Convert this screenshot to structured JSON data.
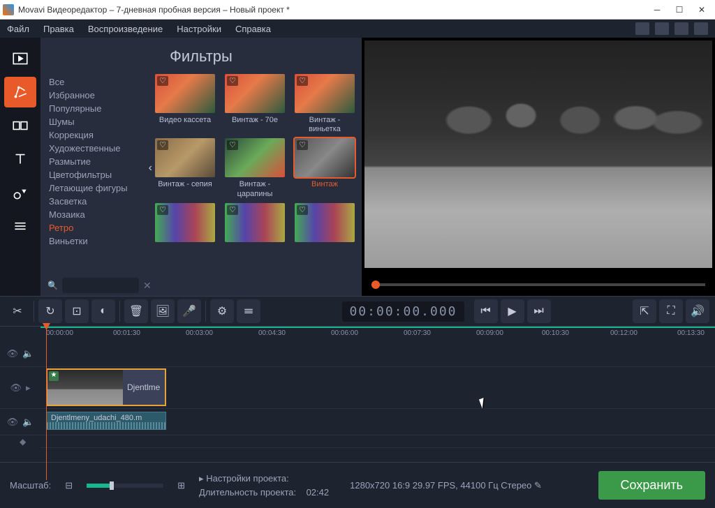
{
  "window": {
    "title": "Movavi Видеоредактор – 7-дневная пробная версия – Новый проект *"
  },
  "menu": {
    "file": "Файл",
    "edit": "Правка",
    "playback": "Воспроизведение",
    "settings": "Настройки",
    "help": "Справка"
  },
  "filters": {
    "title": "Фильтры",
    "categories": [
      "Все",
      "Избранное",
      "Популярные",
      "Шумы",
      "Коррекция",
      "Художественные",
      "Размытие",
      "Цветофильтры",
      "Летающие фигуры",
      "Засветка",
      "Мозаика",
      "Ретро",
      "Виньетки"
    ],
    "active_category_index": 11,
    "items": [
      {
        "label": "Видео кассета"
      },
      {
        "label": "Винтаж - 70е"
      },
      {
        "label": "Винтаж - виньетка"
      },
      {
        "label": "Винтаж - сепия"
      },
      {
        "label": "Винтаж - царапины"
      },
      {
        "label": "Винтаж",
        "selected": true
      }
    ]
  },
  "toolbar": {
    "timecode": "00:00:00.000"
  },
  "ruler": [
    "00:00:00",
    "00:01:30",
    "00:03:00",
    "00:04:30",
    "00:06:00",
    "00:07:30",
    "00:09:00",
    "00:10:30",
    "00:12:00",
    "00:13:30"
  ],
  "clips": {
    "video_label": "Djentlmе",
    "audio_label": "Djentlmeny_udachi_480.m"
  },
  "status": {
    "zoom_label": "Масштаб:",
    "proj_settings_label": "Настройки проекта:",
    "proj_settings_value": "1280x720 16:9 29.97 FPS, 44100 Гц Стерео",
    "duration_label": "Длительность проекта:",
    "duration_value": "02:42",
    "save": "Сохранить"
  }
}
